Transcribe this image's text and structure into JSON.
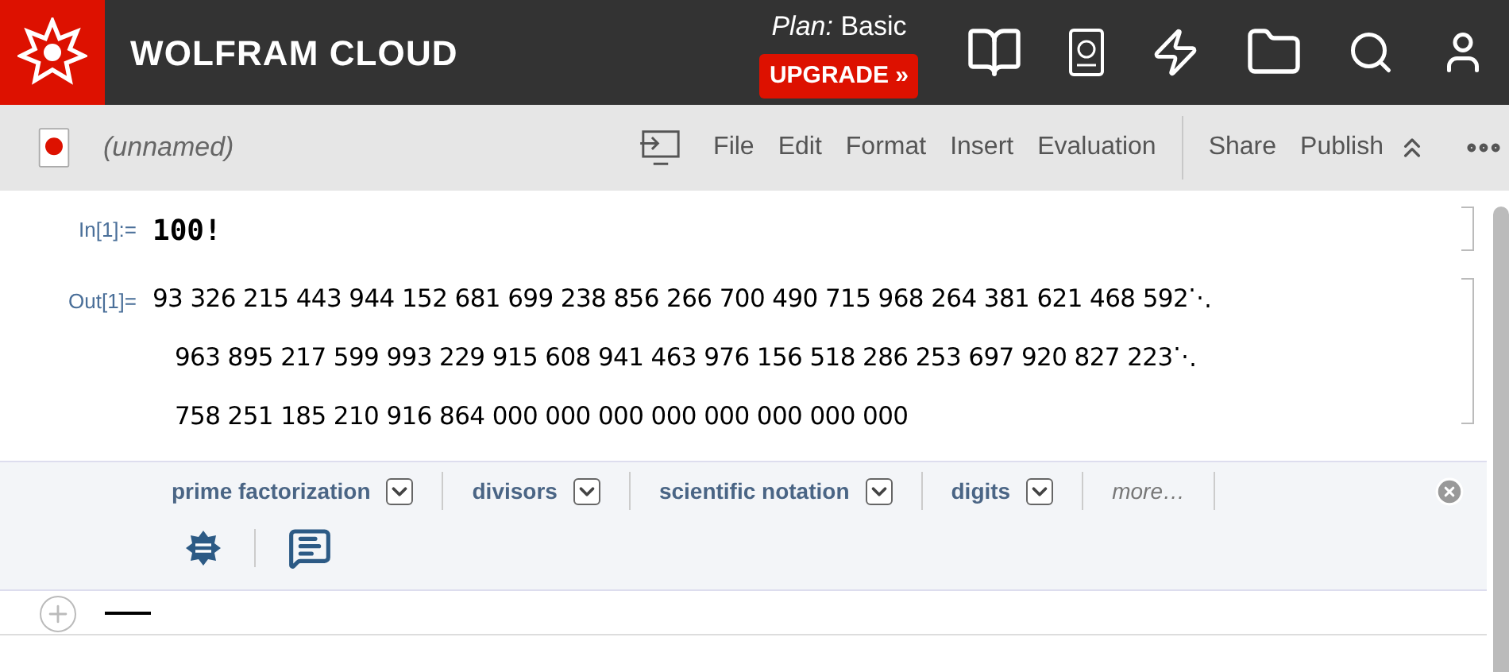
{
  "header": {
    "brand": "WOLFRAM CLOUD",
    "plan_label": "Plan:",
    "plan": "Basic",
    "upgrade": "UPGRADE »"
  },
  "toolbar": {
    "title": "(unnamed)",
    "menu": [
      "File",
      "Edit",
      "Format",
      "Insert",
      "Evaluation"
    ],
    "actions": [
      "Share",
      "Publish"
    ]
  },
  "cells": [
    {
      "label": "In[1]:=",
      "kind": "input",
      "lines": [
        {
          "text": "100!"
        }
      ]
    },
    {
      "label": "Out[1]=",
      "kind": "output",
      "lines": [
        {
          "text": "93 326 215 443 944 152 681 699 238 856 266 700 490 715 968 264 381 621 468 592",
          "mark": "⋱"
        },
        {
          "text": "963 895 217 599 993 229 915 608 941 463 976 156 518 286 253 697 920 827 223",
          "mark": "⋱"
        },
        {
          "text": "758 251 185 210 916 864 000 000 000 000 000 000 000 000"
        }
      ]
    }
  ],
  "suggestions": [
    {
      "label": "prime factorization",
      "kind": "menu"
    },
    {
      "label": "divisors",
      "kind": "menu"
    },
    {
      "label": "scientific notation",
      "kind": "menu"
    },
    {
      "label": "digits",
      "kind": "menu"
    },
    {
      "label": "more…",
      "kind": "more"
    }
  ]
}
